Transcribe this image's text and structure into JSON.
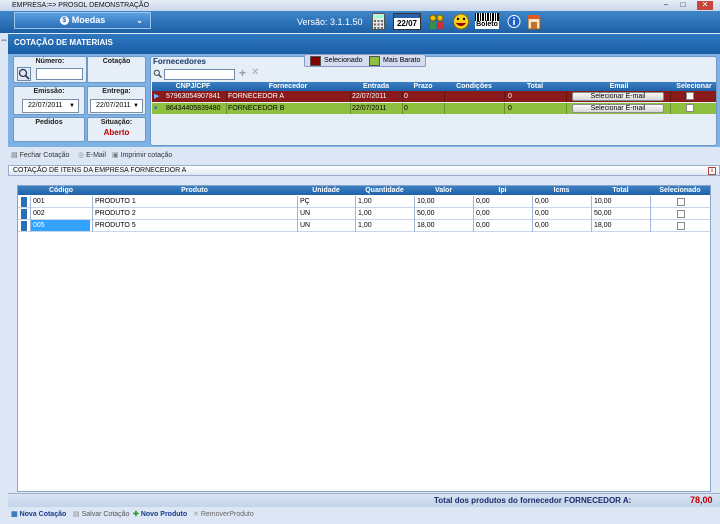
{
  "window": {
    "title": "EMPRESA:=> PROSOL DEMONSTRAÇÃO"
  },
  "topbar": {
    "module": "Moedas",
    "version": "Versão: 3.1.1.50",
    "calendar_date": "22/07",
    "icons": [
      "calculator-icon",
      "calendar-icon",
      "users-icon",
      "smiley-icon",
      "boleto-icon",
      "info-icon",
      "shop-icon"
    ],
    "boleto_label": "Boleto"
  },
  "section": {
    "title": "COTAÇÃO DE MATERIAIS"
  },
  "form": {
    "numero_label": "Número:",
    "numero_value": "",
    "cotacao_label": "Cotação",
    "emissao_label": "Emissão:",
    "emissao_value": "22/07/2011",
    "entrega_label": "Entrega:",
    "entrega_value": "22/07/2011",
    "pedidos_label": "Pedidos",
    "situacao_label": "Situação:",
    "situacao_value": "Aberto"
  },
  "fornecedores": {
    "title": "Fornecedores",
    "search_placeholder": "",
    "legend": [
      {
        "label": "Selecionado",
        "color": "#800000"
      },
      {
        "label": "Mais Barato",
        "color": "#8fbf3f"
      }
    ],
    "columns": [
      "CNPJ/CPF",
      "Fornecedor",
      "Entrada",
      "Prazo",
      "Condições",
      "Total",
      "Email",
      "Selecionar"
    ],
    "rows": [
      {
        "cnpj": "57963054907841",
        "fornecedor": "FORNECEDOR A",
        "entrada": "22/07/2011",
        "prazo": "0",
        "condicoes": "",
        "total": "0",
        "email_button": "Selecionar E-mail",
        "row_color": "#8b1a1a",
        "selected": false
      },
      {
        "cnpj": "86434405839480",
        "fornecedor": "FORNECEDOR B",
        "entrada": "22/07/2011",
        "prazo": "0",
        "condicoes": "",
        "total": "0",
        "email_button": "Selecionar E-mail",
        "row_color": "#8fbf3f",
        "selected": false
      }
    ]
  },
  "toolbar1": {
    "fechar": "Fechar Cotação",
    "email": "E-Mail",
    "imprimir": "Imprimir cotação"
  },
  "itens": {
    "title": "COTAÇÃO DE ITENS DA EMPRESA FORNECEDOR A",
    "columns": [
      "Código",
      "Produto",
      "Unidade",
      "Quantidade",
      "Valor",
      "Ipi",
      "Icms",
      "Total",
      "Selecionado"
    ],
    "rows": [
      {
        "codigo": "001",
        "produto": "PRODUTO 1",
        "unidade": "PÇ",
        "quantidade": "1,00",
        "valor": "10,00",
        "ipi": "0,00",
        "icms": "0,00",
        "total": "10,00",
        "selected": false
      },
      {
        "codigo": "002",
        "produto": "PRODUTO 2",
        "unidade": "UN",
        "quantidade": "1,00",
        "valor": "50,00",
        "ipi": "0,00",
        "icms": "0,00",
        "total": "50,00",
        "selected": false
      },
      {
        "codigo": "005",
        "produto": "PRODUTO 5",
        "unidade": "UN",
        "quantidade": "1,00",
        "valor": "18,00",
        "ipi": "0,00",
        "icms": "0,00",
        "total": "18,00",
        "selected": false
      }
    ]
  },
  "footer": {
    "total_label": "Total dos produtos do fornecedor FORNECEDOR A:",
    "total_value": "78,00"
  },
  "toolbar2": {
    "nova": "Nova Cotação",
    "salvar": "Salvar Cotação",
    "novo_produto": "Novo Produto",
    "remover": "RemoverProduto"
  }
}
